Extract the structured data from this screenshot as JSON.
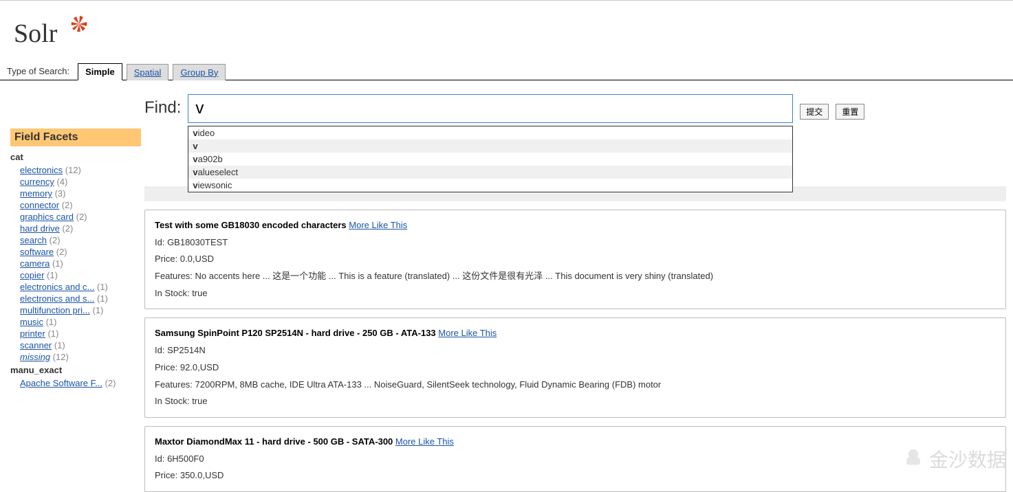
{
  "logo_text": "Solr",
  "tabs": {
    "label": "Type of Search:",
    "items": [
      "Simple",
      "Spatial",
      "Group By"
    ],
    "active": 0
  },
  "find": {
    "label": "Find:",
    "value": "v",
    "submit": "提交",
    "reset": "重置"
  },
  "autocomplete": [
    {
      "bold": "v",
      "rest": "ideo"
    },
    {
      "bold": "v",
      "rest": ""
    },
    {
      "bold": "v",
      "rest": "a902b"
    },
    {
      "bold": "v",
      "rest": "alueselect"
    },
    {
      "bold": "v",
      "rest": "iewsonic"
    }
  ],
  "facets": {
    "header": "Field Facets",
    "groups": [
      {
        "title": "cat",
        "items": [
          {
            "label": "electronics",
            "count": 12
          },
          {
            "label": "currency",
            "count": 4
          },
          {
            "label": "memory",
            "count": 3
          },
          {
            "label": "connector",
            "count": 2
          },
          {
            "label": "graphics card",
            "count": 2
          },
          {
            "label": "hard drive",
            "count": 2
          },
          {
            "label": "search",
            "count": 2
          },
          {
            "label": "software",
            "count": 2
          },
          {
            "label": "camera",
            "count": 1
          },
          {
            "label": "copier",
            "count": 1
          },
          {
            "label": "electronics and c...",
            "count": 1
          },
          {
            "label": "electronics and s...",
            "count": 1
          },
          {
            "label": "multifunction pri...",
            "count": 1
          },
          {
            "label": "music",
            "count": 1
          },
          {
            "label": "printer",
            "count": 1
          },
          {
            "label": "scanner",
            "count": 1
          },
          {
            "label": "missing",
            "count": 12,
            "missing": true
          }
        ]
      },
      {
        "title": "manu_exact",
        "items": [
          {
            "label": "Apache Software F...",
            "count": 2
          }
        ]
      }
    ]
  },
  "results": [
    {
      "title": "Test with some GB18030 encoded characters",
      "mlt": "More Like This",
      "lines": [
        "Id: GB18030TEST",
        "Price: 0.0,USD",
        "Features: No accents here ... 这是一个功能 ... This is a feature (translated) ... 这份文件是很有光泽 ... This document is very shiny (translated)",
        "In Stock: true"
      ]
    },
    {
      "title": "Samsung SpinPoint P120 SP2514N - hard drive - 250 GB - ATA-133",
      "mlt": "More Like This",
      "lines": [
        "Id: SP2514N",
        "Price: 92.0,USD",
        "Features: 7200RPM, 8MB cache, IDE Ultra ATA-133 ... NoiseGuard, SilentSeek technology, Fluid Dynamic Bearing (FDB) motor",
        "In Stock: true"
      ]
    },
    {
      "title": "Maxtor DiamondMax 11 - hard drive - 500 GB - SATA-300",
      "mlt": "More Like This",
      "lines": [
        "Id: 6H500F0",
        "Price: 350.0,USD"
      ]
    }
  ],
  "watermark": "金沙数据"
}
